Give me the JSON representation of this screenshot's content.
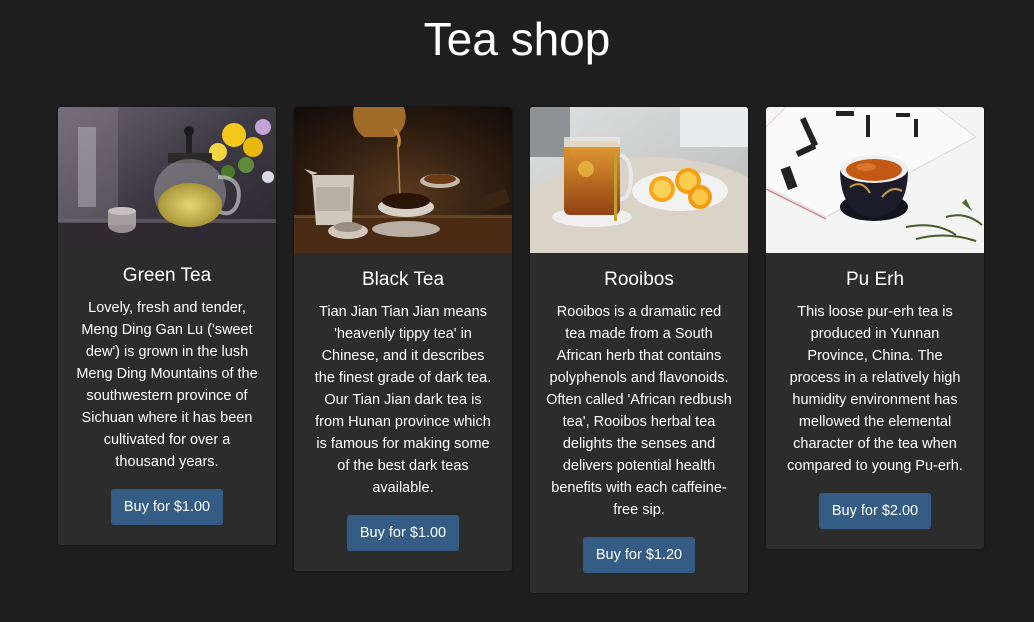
{
  "page": {
    "title": "Tea shop"
  },
  "products": [
    {
      "name": "Green Tea",
      "description": "Lovely, fresh and tender, Meng Ding Gan Lu ('sweet dew') is grown in the lush Meng Ding Mountains of the southwestern province of Sichuan where it has been cultivated for over a thousand years.",
      "buy_label": "Buy for $1.00"
    },
    {
      "name": "Black Tea",
      "description": "Tian Jian Tian Jian means 'heavenly tippy tea' in Chinese, and it describes the finest grade of dark tea. Our Tian Jian dark tea is from Hunan province which is famous for making some of the best dark teas available.",
      "buy_label": "Buy for $1.00"
    },
    {
      "name": "Rooibos",
      "description": "Rooibos is a dramatic red tea made from a South African herb that contains polyphenols and flavonoids. Often called 'African redbush tea', Rooibos herbal tea delights the senses and delivers potential health benefits with each caffeine-free sip.",
      "buy_label": "Buy for $1.20"
    },
    {
      "name": "Pu Erh",
      "description": "This loose pur-erh tea is produced in Yunnan Province, China. The process in a relatively high humidity environment has mellowed the elemental character of the tea when compared to young Pu-erh.",
      "buy_label": "Buy for $2.00"
    }
  ],
  "colors": {
    "background": "#1e1e1e",
    "card": "#2c2c2c",
    "button": "#345c85"
  }
}
